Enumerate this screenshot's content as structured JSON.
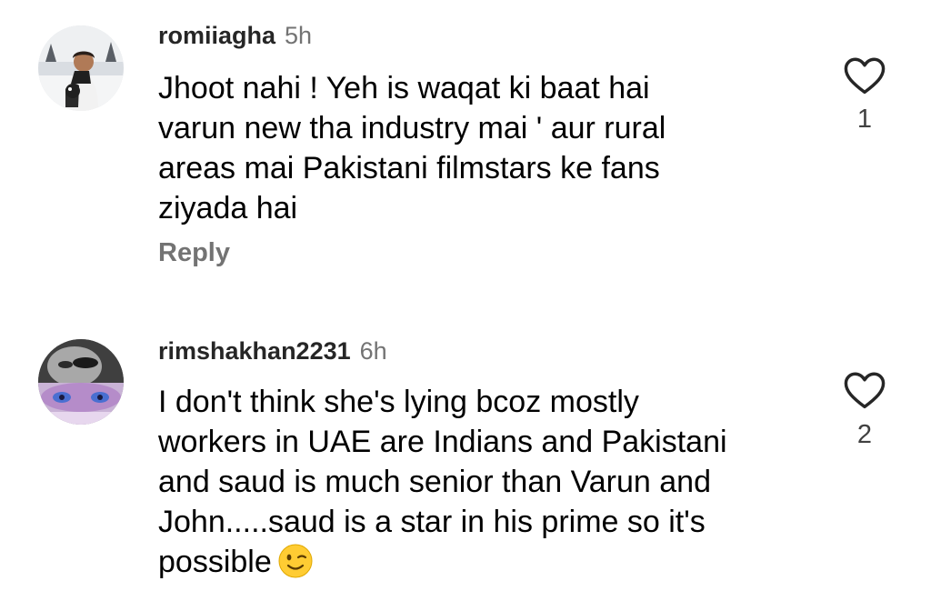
{
  "comments": [
    {
      "username": "romiiagha",
      "time": "5h",
      "lines": [
        "Jhoot nahi ! Yeh is waqat ki baat hai",
        "varun new tha industry mai ' aur rural",
        "areas mai Pakistani filmstars ke fans",
        "ziyada hai"
      ],
      "reply_label": "Reply",
      "like_count": "1"
    },
    {
      "username": "rimshakhan2231",
      "time": "6h",
      "lines": [
        "I don't think she's lying bcoz mostly",
        "workers in UAE are Indians and Pakistani",
        "and saud is much senior than Varun and",
        "John.....saud is a star in his prime so it's",
        "possible"
      ],
      "emoji": "winking-face",
      "like_count": "2"
    }
  ],
  "colors": {
    "username": "#262626",
    "timestamp": "#737373",
    "reply": "#737373",
    "heart_outline": "#262626",
    "like_count": "#404040"
  },
  "icons": {
    "like": "heart-outline-icon",
    "emoji": "winking-face-emoji"
  }
}
